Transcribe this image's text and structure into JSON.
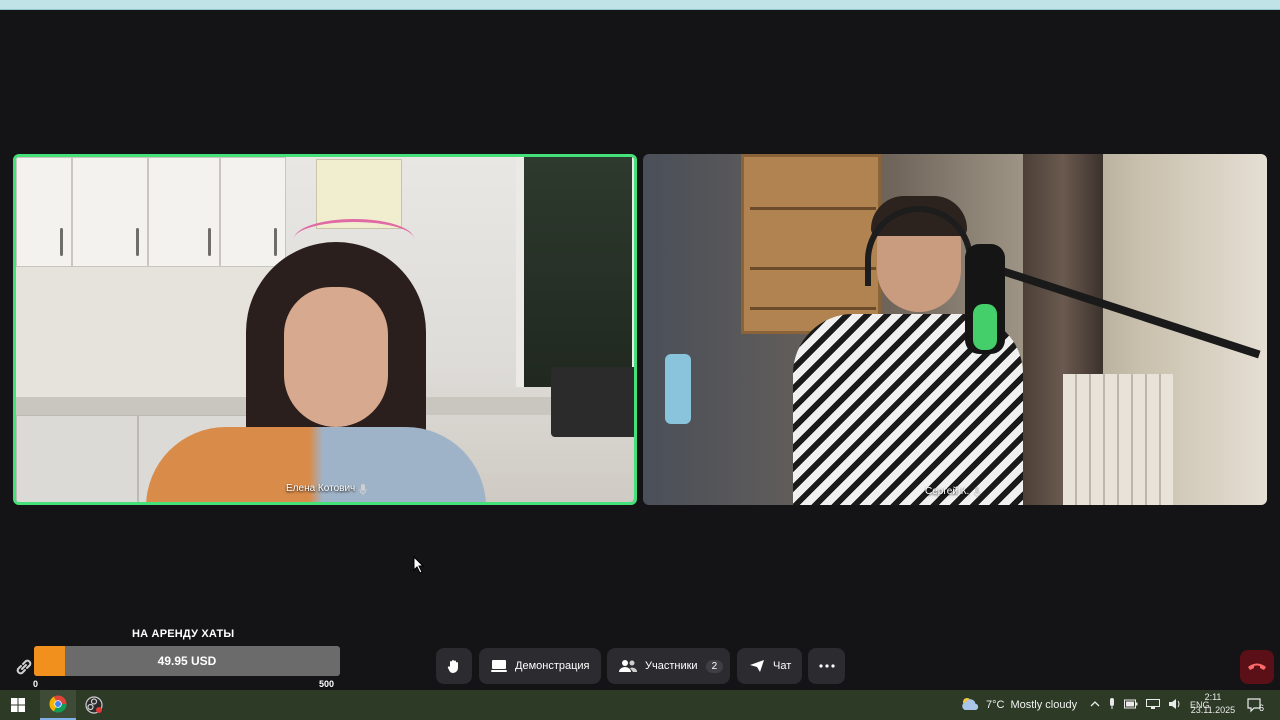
{
  "call": {
    "participants_tiles": [
      {
        "name": "Елена Котович",
        "active_speaker": true
      },
      {
        "name": "Сергей К.",
        "active_speaker": false
      }
    ]
  },
  "donation": {
    "title": "НА АРЕНДУ ХАТЫ",
    "amount": "49.95 USD",
    "min": "0",
    "max": "500",
    "progress_fraction": 0.0999
  },
  "toolbar": {
    "demo_label": "Демонстрация",
    "participants_label": "Участники",
    "participants_count": "2",
    "chat_label": "Чат"
  },
  "taskbar": {
    "weather_temp": "7°C",
    "weather_text": "Mostly cloudy",
    "language": "ENG",
    "time": "2:11",
    "date": "23.11.2025",
    "notifications_count": "6"
  },
  "colors": {
    "active_border": "#45e07a",
    "donation_fill": "#f2901e",
    "hangup": "#5a1016"
  }
}
